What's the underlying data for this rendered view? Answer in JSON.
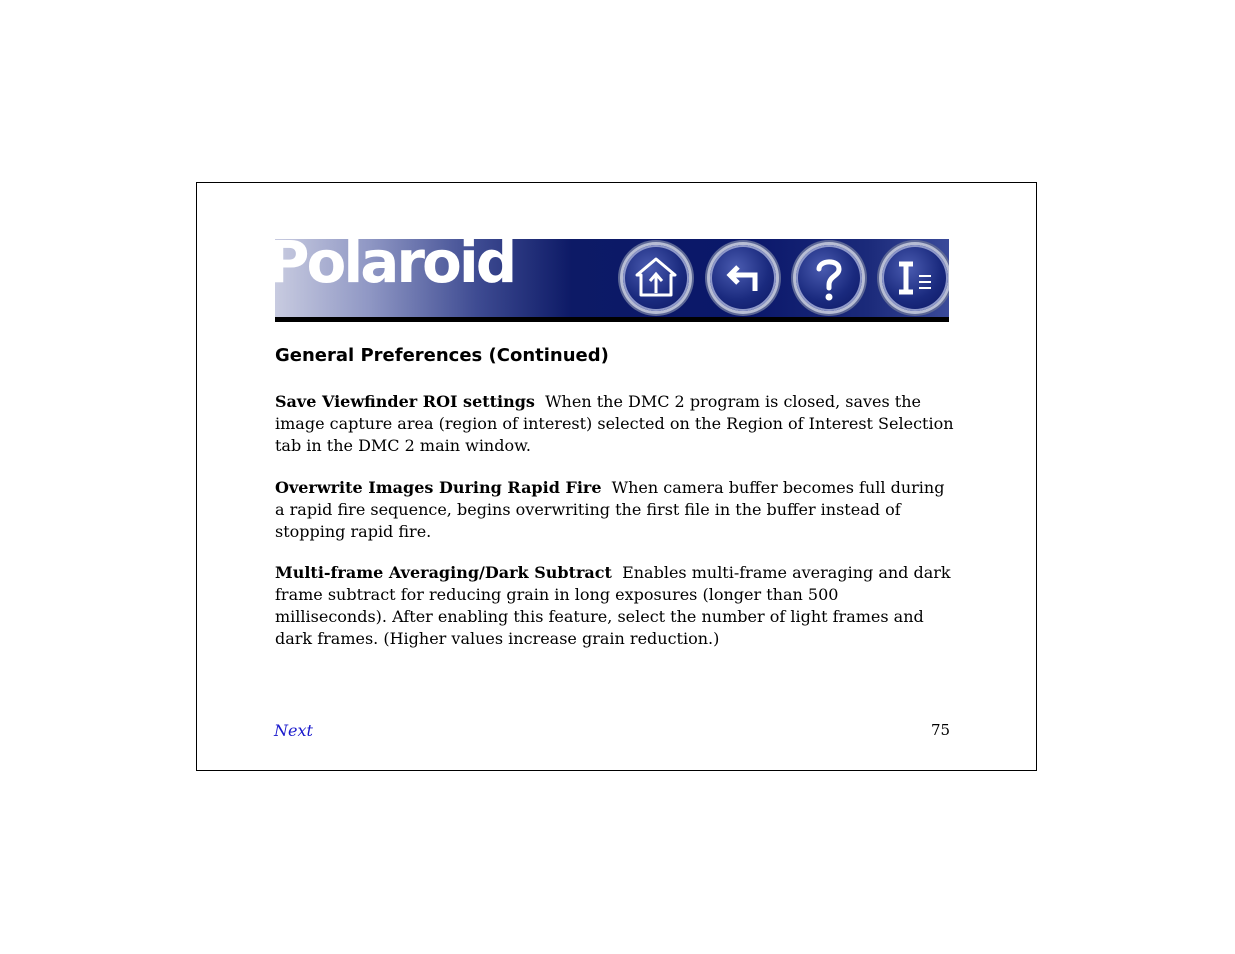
{
  "header": {
    "logo_text": "Polaroid",
    "nav": [
      {
        "icon": "home-icon"
      },
      {
        "icon": "back-arrow-icon"
      },
      {
        "icon": "help-icon"
      },
      {
        "icon": "index-icon"
      }
    ]
  },
  "content": {
    "heading": "General Preferences (Continued)",
    "items": [
      {
        "term": "Save Viewfinder ROI settings",
        "description": "When the DMC 2 program is closed, saves the image capture area (region of interest) selected on the Region of Interest Selection tab in the DMC 2 main window."
      },
      {
        "term": "Overwrite Images During Rapid Fire",
        "description": "When camera buffer becomes full during a rapid fire sequence, begins overwriting the first file in the buffer instead of stopping rapid fire."
      },
      {
        "term": "Multi-frame Averaging/Dark Subtract",
        "description": "Enables multi-frame averaging and dark frame subtract for reducing grain in long exposures (longer than 500 milliseconds). After enabling this feature, select the number of light frames and dark frames. (Higher values increase grain reduction.)"
      }
    ]
  },
  "footer": {
    "next_label": "Next",
    "page_number": "75"
  },
  "colors": {
    "banner_blue": "#0d1a66",
    "link_blue": "#1a1acc"
  }
}
